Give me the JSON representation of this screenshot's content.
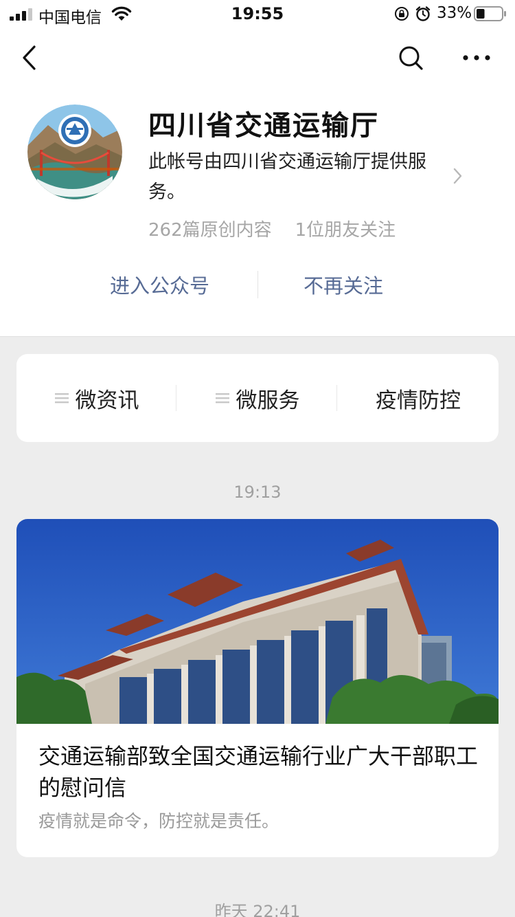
{
  "status_bar": {
    "carrier": "中国电信",
    "time": "19:55",
    "battery_percent": "33%",
    "battery_level": 0.33,
    "icons": [
      "signal-icon",
      "wifi-icon",
      "orientation-lock-icon",
      "alarm-icon",
      "battery-icon"
    ]
  },
  "nav": {
    "icons": [
      "back-chevron-icon",
      "search-icon",
      "more-icon"
    ]
  },
  "account": {
    "name": "四川省交通运输厅",
    "description": "此帐号由四川省交通运输厅提供服务。",
    "original_count": "262篇原创内容",
    "friends_following": "1位朋友关注",
    "avatar_text": "四川省交通运输厅",
    "enter_button": "进入公众号",
    "unfollow_button": "不再关注"
  },
  "menu": {
    "items": [
      {
        "label": "微资讯",
        "has_submenu": true
      },
      {
        "label": "微服务",
        "has_submenu": true
      },
      {
        "label": "疫情防控",
        "has_submenu": false
      }
    ]
  },
  "feed": {
    "groups": [
      {
        "time": "19:13",
        "article": {
          "title": "交通运输部致全国交通运输行业广大干部职工的慰问信",
          "digest": "疫情就是命令，防控就是责任。"
        }
      },
      {
        "time": "昨天 22:41"
      }
    ]
  },
  "colors": {
    "link": "#576b95",
    "background": "#ededed",
    "muted": "#a6a6a6"
  }
}
